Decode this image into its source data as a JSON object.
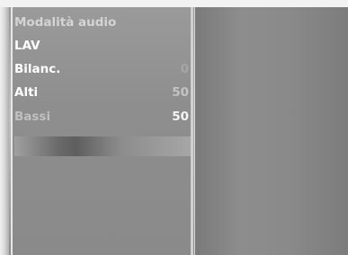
{
  "menu": {
    "title": "Modalità audio",
    "items": [
      {
        "label": "LAV",
        "value": ""
      },
      {
        "label": "Bilanc.",
        "value": "0"
      },
      {
        "label": "Alti",
        "value": "50"
      },
      {
        "label": "Bassi",
        "value": "50"
      }
    ]
  }
}
